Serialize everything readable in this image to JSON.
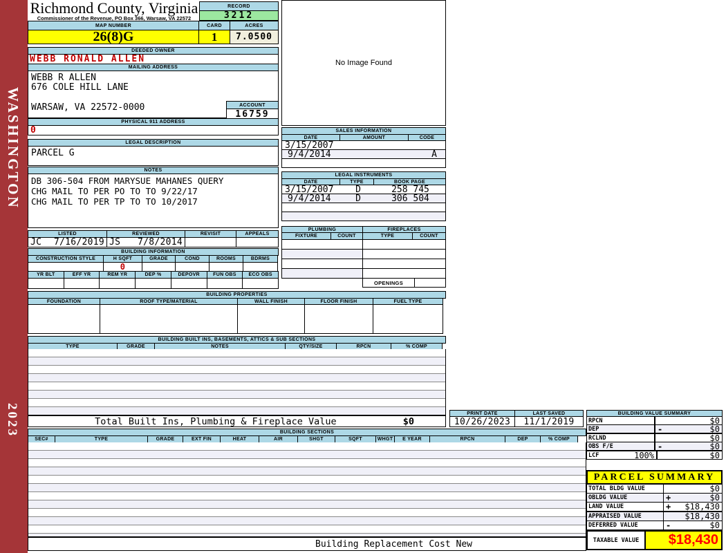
{
  "colors": {
    "sidebar": "#A53538",
    "band_blue": "#ADD8E6",
    "record_green": "#9CE8A0",
    "highlight_yellow": "#FFFF00",
    "acres_cream": "#F1EFDE",
    "stripe": "#F0F0F8",
    "alert_red": "#C00000",
    "taxable_red": "#FF0000"
  },
  "sidebar": {
    "district": "WASHINGTON",
    "year": "2023"
  },
  "header": {
    "county": "Richmond County, Virginia",
    "commissioner": "Commissioner of the Revenue, PO Box 366, Warsaw, VA 22572",
    "record_label": "RECORD",
    "record_value": "3212",
    "map_label": "MAP NUMBER",
    "map_value": "26(8)G",
    "card_label": "CARD",
    "card_value": "1",
    "acres_label": "ACRES",
    "acres_value": "7.0500"
  },
  "owner": {
    "label": "DEEDED OWNER",
    "name": "WEBB RONALD ALLEN"
  },
  "mailing": {
    "label": "MAILING ADDRESS",
    "line1": "WEBB R ALLEN",
    "line2": "676 COLE HILL LANE",
    "line3": "WARSAW, VA 22572-0000"
  },
  "account": {
    "label": "ACCOUNT",
    "value": "16759"
  },
  "physical911": {
    "label": "PHYSICAL 911 ADDRESS",
    "value": "0"
  },
  "legal": {
    "label": "LEGAL DESCRIPTION",
    "value": "PARCEL G"
  },
  "notes": {
    "label": "NOTES",
    "line1": "DB 306-504 FROM MARYSUE MAHANES QUERY",
    "line2": "CHG MAIL TO PER PO TO TO 9/22/17",
    "line3": "CHG MAIL TO PER TP TO TO 10/2017"
  },
  "review": {
    "listed_label": "LISTED",
    "reviewed_label": "REVIEWED",
    "revisit_label": "REVISIT",
    "appeals_label": "APPEALS",
    "listed_by": "JC",
    "listed_date": "7/16/2019",
    "reviewed_by": "JS",
    "reviewed_date": "7/8/2014",
    "revisit": "",
    "appeals": ""
  },
  "image_panel": {
    "text": "No Image Found"
  },
  "sales": {
    "title": "SALES INFORMATION",
    "h_date": "DATE",
    "h_amount": "AMOUNT",
    "h_code": "CODE",
    "rows": [
      {
        "date": "3/15/2007",
        "amount": "",
        "code": ""
      },
      {
        "date": "9/4/2014",
        "amount": "",
        "code": "A"
      }
    ]
  },
  "instruments": {
    "title": "LEGAL INSTRUMENTS",
    "h_date": "DATE",
    "h_type": "TYPE",
    "h_book": "BOOK PAGE",
    "rows": [
      {
        "date": "3/15/2007",
        "type": "D",
        "book": "258 745"
      },
      {
        "date": "9/4/2014",
        "type": "D",
        "book": "306 504"
      }
    ]
  },
  "plumbing": {
    "title": "PLUMBING",
    "h_fixture": "FIXTURE",
    "h_count": "COUNT"
  },
  "fireplaces": {
    "title": "FIREPLACES",
    "h_type": "TYPE",
    "h_count": "COUNT",
    "openings": "OPENINGS"
  },
  "bldg_info": {
    "title": "BUILDING INFORMATION",
    "h1": [
      "CONSTRUCTION STYLE",
      "H SQFT",
      "GRADE",
      "COND",
      "ROOMS",
      "BDRMS"
    ],
    "hsqft_value": "0",
    "h2": [
      "YR BLT",
      "EFF YR",
      "REM YR",
      "DEP %",
      "DEPOVR",
      "FUN OBS",
      "ECO OBS"
    ]
  },
  "bldg_props": {
    "title": "BUILDING PROPERTIES",
    "h": [
      "FOUNDATION",
      "ROOF TYPE/MATERIAL",
      "WALL FINISH",
      "FLOOR FINISH",
      "FUEL TYPE"
    ]
  },
  "built_ins": {
    "title": "BUILDING BUILT INS, BASEMENTS, ATTICS & SUB SECTIONS",
    "h": [
      "TYPE",
      "GRADE",
      "NOTES",
      "QTY/SIZE",
      "RPCN",
      "% COMP"
    ],
    "total_label": "Total Built Ins, Plumbing & Fireplace Value",
    "total_value": "$0"
  },
  "print_info": {
    "print_label": "PRINT DATE",
    "print_date": "10/26/2023",
    "saved_label": "LAST SAVED",
    "saved_date": "11/1/2019"
  },
  "bvs": {
    "title": "BUILDING VALUE SUMMARY",
    "rows": [
      {
        "label": "RPCN",
        "op": "",
        "value": "$0"
      },
      {
        "label": "DEP",
        "op": "-",
        "value": "$0"
      },
      {
        "label": "RCLND",
        "op": "",
        "value": "$0"
      },
      {
        "label": "OBS F/E",
        "op": "-",
        "value": "$0"
      },
      {
        "label": "LCF",
        "pct": "100%",
        "op": "",
        "value": "$0"
      }
    ]
  },
  "sections": {
    "title": "BUILDING SECTIONS",
    "h": [
      "SEC#",
      "TYPE",
      "GRADE",
      "EXT FIN",
      "HEAT",
      "AIR",
      "SHGT",
      "SQFT",
      "WHGT",
      "E YEAR",
      "RPCN",
      "DEP",
      "% COMP"
    ],
    "footer": "Building Replacement Cost New"
  },
  "parcel": {
    "title": "PARCEL SUMMARY",
    "rows": [
      {
        "label": "TOTAL BLDG VALUE",
        "op": "",
        "value": "$0"
      },
      {
        "label": "OBLDG VALUE",
        "op": "+",
        "value": "$0"
      },
      {
        "label": "LAND VALUE",
        "op": "+",
        "value": "$18,430"
      },
      {
        "label": "APPRAISED VALUE",
        "op": "",
        "value": "$18,430"
      },
      {
        "label": "DEFERRED VALUE",
        "op": "-",
        "value": "$0"
      }
    ],
    "taxable_label": "TAXABLE VALUE",
    "taxable_value": "$18,430"
  }
}
